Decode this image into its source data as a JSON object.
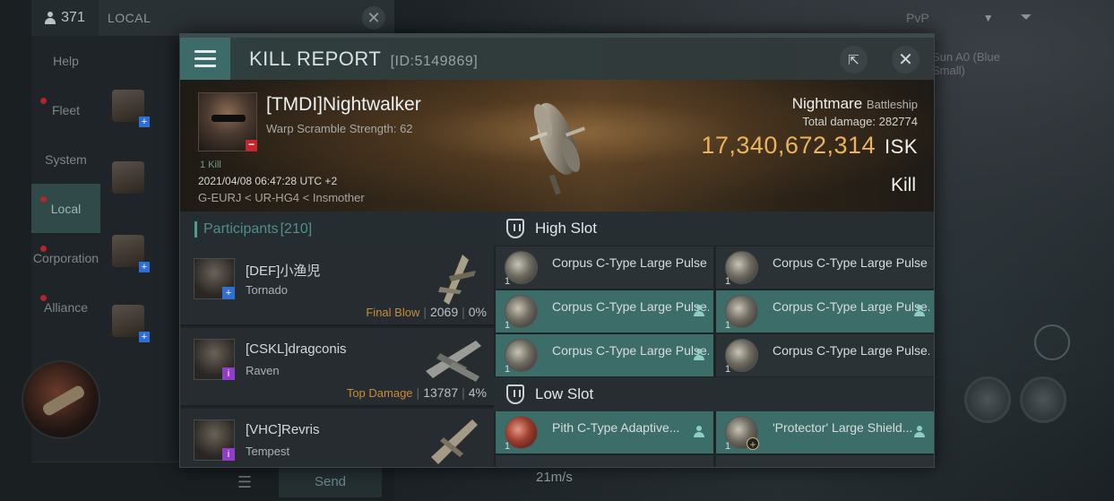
{
  "background": {
    "chat": {
      "online_count": "371",
      "channel_title": "LOCAL",
      "tabs": [
        {
          "label": "Help",
          "alert": false
        },
        {
          "label": "Fleet",
          "alert": true
        },
        {
          "label": "System",
          "alert": false
        },
        {
          "label": "Local",
          "alert": true,
          "active": true
        },
        {
          "label": "Corporation",
          "alert": true
        },
        {
          "label": "Alliance",
          "alert": true
        }
      ],
      "send_label": "Send"
    },
    "hud": {
      "pvp_label": "PvP",
      "overview_text": "Sun A0 (Blue Small)",
      "speed": "21m/s"
    }
  },
  "kill_report": {
    "title": "KILL REPORT",
    "report_id": "[ID:5149869]",
    "victim": {
      "name": "[TMDI]Nightwalker",
      "warp_scramble": "Warp Scramble Strength: 62",
      "kill_count": "1 Kill",
      "datetime": "2021/04/08 06:47:28 UTC +2",
      "location": "G-EURJ < UR-HG4 < Insmother",
      "ship_name": "Nightmare",
      "ship_class": "Battleship",
      "total_damage_label": "Total damage:",
      "total_damage": "282774",
      "isk_value": "17,340,672,314",
      "isk_unit": "ISK",
      "result": "Kill"
    },
    "participants": {
      "label": "Participants",
      "count": "[210]",
      "rows": [
        {
          "name": "[DEF]小渔児",
          "ship": "Tornado",
          "tag": "Final Blow",
          "damage": "2069",
          "percent": "0%",
          "badge": "+"
        },
        {
          "name": "[CSKL]dragconis",
          "ship": "Raven",
          "tag": "Top Damage",
          "damage": "13787",
          "percent": "4%",
          "badge": "i"
        },
        {
          "name": "[VHC]Revris",
          "ship": "Tempest",
          "tag": "",
          "damage": "",
          "percent": "",
          "badge": "i"
        }
      ]
    },
    "fitting": {
      "high_slot_label": "High Slot",
      "low_slot_label": "Low Slot",
      "high_slot_items": [
        {
          "name": "Corpus C-Type Large Pulse ...",
          "qty": "1",
          "dropped": false
        },
        {
          "name": "Corpus C-Type Large Pulse ...",
          "qty": "1",
          "dropped": false
        },
        {
          "name": "Corpus C-Type Large Pulse...",
          "qty": "1",
          "dropped": true
        },
        {
          "name": "Corpus C-Type Large Pulse...",
          "qty": "1",
          "dropped": true
        },
        {
          "name": "Corpus C-Type Large Pulse...",
          "qty": "1",
          "dropped": true
        },
        {
          "name": "Corpus C-Type Large Pulse...",
          "qty": "1",
          "dropped": false
        }
      ],
      "low_slot_items": [
        {
          "name": "Pith C-Type Adaptive...",
          "qty": "1",
          "dropped": true
        },
        {
          "name": "'Protector' Large Shield...",
          "qty": "1",
          "dropped": true
        }
      ]
    }
  },
  "colors": {
    "accent_teal": "#3c6b69",
    "isk_gold": "#e9b45e",
    "final_blow_orange": "#c58d3a",
    "alert_red": "#b3242c"
  },
  "icons": [
    "user-icon",
    "close-icon",
    "menu-icon",
    "share-icon",
    "shield-slot-icon",
    "person-icon",
    "filter-icon",
    "chevron-down-icon"
  ]
}
